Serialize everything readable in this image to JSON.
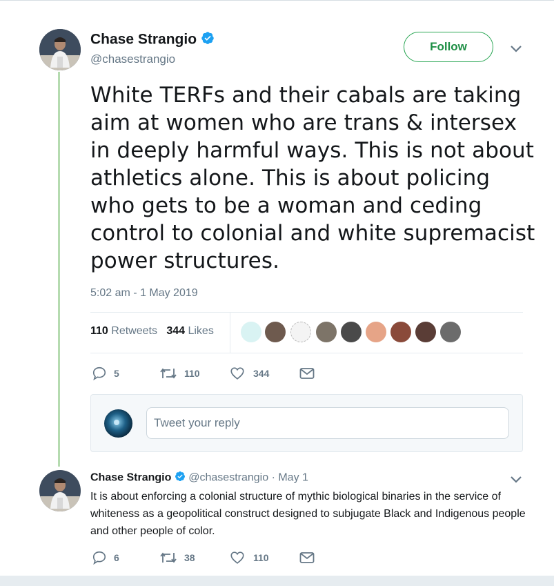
{
  "tweet": {
    "author_name": "Chase Strangio",
    "author_handle": "@chasestrangio",
    "follow_label": "Follow",
    "text": "White TERFs and their cabals are taking aim at women who are trans & intersex in deeply harmful ways. This is not about athletics alone. This is about policing who gets to be a woman and ceding control to colonial and white supremacist power structures.",
    "timestamp": "5:02 am - 1 May 2019",
    "retweets_count": "110",
    "retweets_label": "Retweets",
    "likes_count": "344",
    "likes_label": "Likes",
    "actions": {
      "replies": "5",
      "retweets": "110",
      "likes": "344"
    }
  },
  "reply_composer": {
    "placeholder": "Tweet your reply"
  },
  "reply": {
    "author_name": "Chase Strangio",
    "author_handle": "@chasestrangio",
    "date": "· May 1",
    "text": "It is about enforcing a colonial structure of mythic biological binaries in the service of whiteness as a geopolitical construct designed to subjugate Black and Indigenous people and other people of color.",
    "actions": {
      "replies": "6",
      "retweets": "38",
      "likes": "110"
    }
  },
  "colors": {
    "verified": "#1da1f2",
    "follow_border": "#27a552",
    "thread_line": "#b5dbb0",
    "muted_text": "#657786"
  },
  "icons": [
    "verified-badge-icon",
    "chevron-down-icon",
    "reply-icon",
    "retweet-icon",
    "like-icon",
    "message-icon"
  ]
}
